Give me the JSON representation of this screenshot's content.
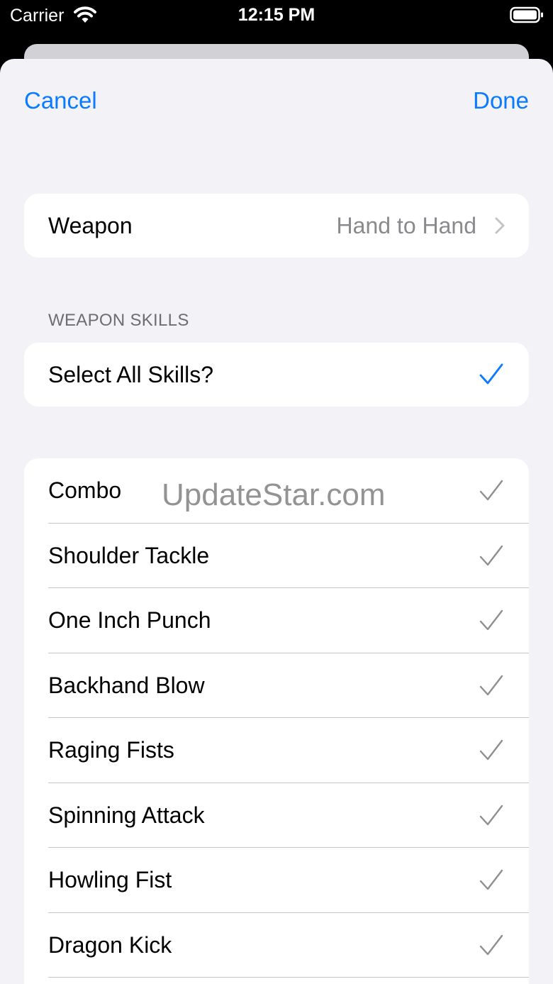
{
  "status_bar": {
    "carrier": "Carrier",
    "time": "12:15 PM"
  },
  "nav": {
    "cancel": "Cancel",
    "done": "Done"
  },
  "weapon_row": {
    "label": "Weapon",
    "value": "Hand to Hand"
  },
  "section": {
    "header": "WEAPON SKILLS"
  },
  "select_all": {
    "label": "Select All Skills?",
    "checked": true
  },
  "skills": [
    {
      "label": "Combo",
      "checked": true
    },
    {
      "label": "Shoulder Tackle",
      "checked": true
    },
    {
      "label": "One Inch Punch",
      "checked": true
    },
    {
      "label": "Backhand Blow",
      "checked": true
    },
    {
      "label": "Raging Fists",
      "checked": true
    },
    {
      "label": "Spinning Attack",
      "checked": true
    },
    {
      "label": "Howling Fist",
      "checked": true
    },
    {
      "label": "Dragon Kick",
      "checked": true
    }
  ],
  "watermark": "UpdateStar.com",
  "colors": {
    "accent": "#0a7aff",
    "background": "#f2f2f7",
    "check_inactive": "#8e8e93"
  }
}
